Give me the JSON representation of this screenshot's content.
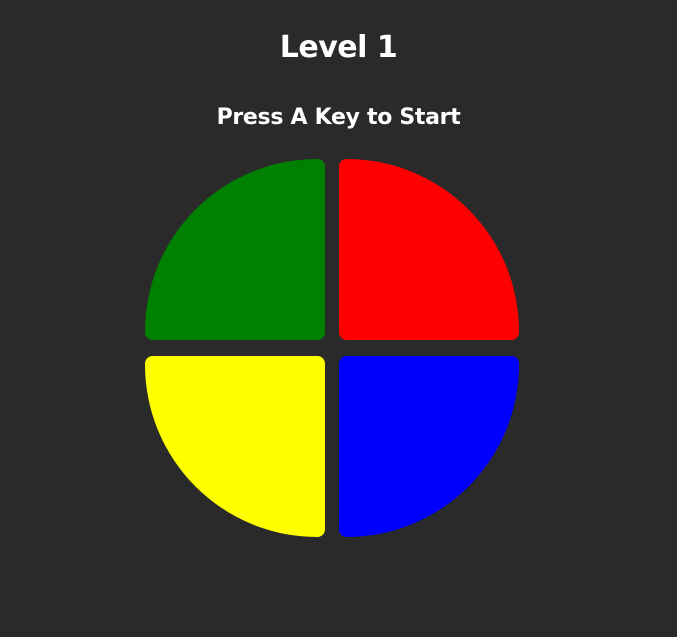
{
  "game": {
    "level_title": "Level 1",
    "instruction": "Press A Key to Start"
  },
  "buttons": [
    {
      "id": "green",
      "color": "#008000"
    },
    {
      "id": "red",
      "color": "#ff0000"
    },
    {
      "id": "yellow",
      "color": "#ffff00"
    },
    {
      "id": "blue",
      "color": "#0000ff"
    }
  ],
  "theme": {
    "background": "#2a2a2a",
    "text": "#ffffff"
  }
}
